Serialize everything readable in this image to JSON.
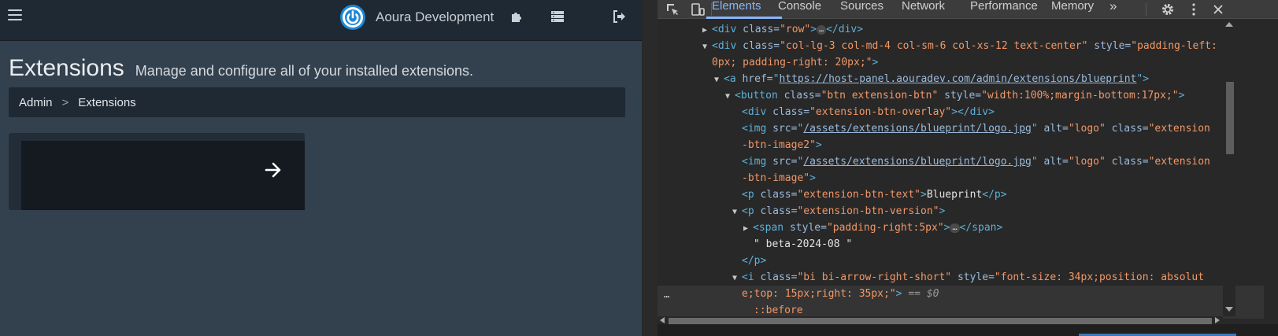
{
  "site": {
    "brand_name": "Aoura Development",
    "page_title": "Extensions",
    "page_subtitle": "Manage and configure all of your installed extensions.",
    "breadcrumb": [
      "Admin",
      "Extensions"
    ],
    "breadcrumb_separator": ">",
    "icons": [
      "hamburger-menu-icon",
      "power-logo-icon",
      "puzzle-icon",
      "server-icon",
      "sign-out-icon",
      "arrow-right-icon"
    ],
    "colors": {
      "brand_blue": "#1e88d6",
      "content_bg": "#33404d",
      "topbar_bg": "#1f2933"
    }
  },
  "devtools": {
    "tabs": [
      "Elements",
      "Console",
      "Sources",
      "Network",
      "Performance",
      "Memory"
    ],
    "active_tab": "Elements",
    "more_tabs": "»",
    "dom": {
      "l1_tag": "<div",
      "l1_attr": " class=",
      "l1_val": "\"row\"",
      "l1_end": "</div>",
      "l2_attr": " class=",
      "l2_val": "\"col-lg-3 col-md-4 col-sm-6 col-xs-12 text-center\"",
      "l2_attr2": " style=",
      "l2_val2a": "\"padding-left:",
      "l2_val2b": "0px; padding-right: 20px;\"",
      "l3_tag": "<a",
      "l3_attr": " href=",
      "l3_link": "https://host-panel.aouradev.com/admin/extensions/blueprint",
      "l4_tag": "<button",
      "l4_attr": " class=",
      "l4_val": "\"btn extension-btn\"",
      "l4_attr2": " style=",
      "l4_val2": "\"width:100%;margin-bottom:17px;\"",
      "l5_attr": " class=",
      "l5_val": "\"extension-btn-overlay\"",
      "l6_tag": "<img",
      "l6_attr": " src=",
      "l6_link": "/assets/extensions/blueprint/logo.jpg",
      "l6_attr2": " alt=",
      "l6_val2": "\"logo\"",
      "l6_attr3": " class=",
      "l6_val3a": "\"extension",
      "l6_val3b": "-btn-image2\"",
      "l7_val3b": "-btn-image\"",
      "l8_tag": "<p",
      "l8_attr": " class=",
      "l8_val": "\"extension-btn-text\"",
      "l8_text": "Blueprint",
      "l8_end": "</p>",
      "l9_val": "\"extension-btn-version\"",
      "l10_tag": "<span",
      "l10_attr": " style=",
      "l10_val": "\"padding-right:5px\"",
      "l10_end": "</span>",
      "l11_text": "\" beta-2024-08 \"",
      "l12_end": "</p>",
      "l13_tag": "<i",
      "l13_attr": " class=",
      "l13_val": "\"bi bi-arrow-right-short\"",
      "l13_attr2": " style=",
      "l13_val2a": "\"font-size: 34px;position: absolut",
      "l13_val2b": "e;top: 15px;right: 35px;\"",
      "l13_eq": " == ",
      "l13_dollar": "$0",
      "l15_text": "::before",
      "ellipsis": "…",
      "gutter": "…"
    }
  }
}
